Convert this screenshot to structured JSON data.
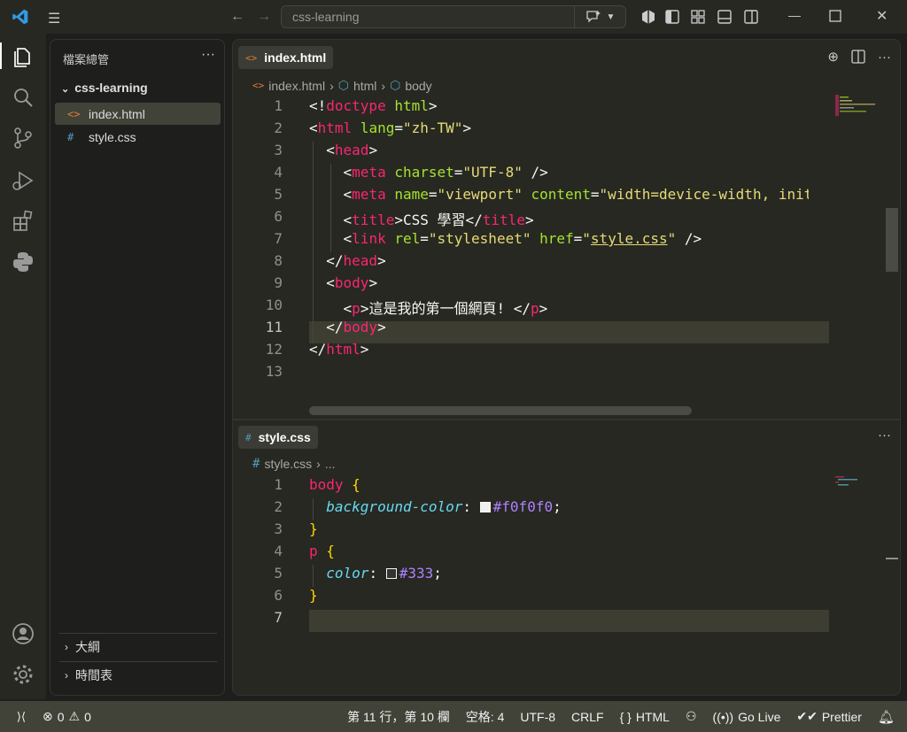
{
  "titlebar": {
    "search_text": "css-learning",
    "menu_icon": "hamburger-icon",
    "back_icon": "arrow-left-icon",
    "forward_icon": "arrow-right-icon"
  },
  "sidebar": {
    "title": "檔案總管",
    "folder": "css-learning",
    "files": [
      {
        "name": "index.html",
        "icon": "<>",
        "icon_color": "#e37933"
      },
      {
        "name": "style.css",
        "icon": "#",
        "icon_color": "#519aba"
      }
    ],
    "sections": [
      "大綱",
      "時間表"
    ]
  },
  "editor_top": {
    "tab_label": "index.html",
    "tab_icon": "<>",
    "breadcrumb": [
      "index.html",
      "html",
      "body"
    ],
    "current_line": 11
  },
  "editor_bottom": {
    "tab_label": "style.css",
    "tab_icon": "#",
    "breadcrumb": [
      "style.css",
      "..."
    ],
    "current_line": 7
  },
  "html_lines": [
    "1",
    "2",
    "3",
    "4",
    "5",
    "6",
    "7",
    "8",
    "9",
    "10",
    "11",
    "12",
    "13"
  ],
  "css_lines": [
    "1",
    "2",
    "3",
    "4",
    "5",
    "6",
    "7"
  ],
  "html_code": {
    "l1a": "<!",
    "l1b": "doctype",
    "l1c": " html",
    "l1d": ">",
    "l2a": "<",
    "l2b": "html",
    "l2c": " lang",
    "l2d": "=",
    "l2e": "\"zh-TW\"",
    "l2f": ">",
    "l3a": "<",
    "l3b": "head",
    "l3c": ">",
    "l4a": "<",
    "l4b": "meta",
    "l4c": " charset",
    "l4d": "=",
    "l4e": "\"UTF-8\"",
    "l4f": " />",
    "l5a": "<",
    "l5b": "meta",
    "l5c": " name",
    "l5d": "=",
    "l5e": "\"viewport\"",
    "l5f": " content",
    "l5g": "=",
    "l5h": "\"width=device-width, initial-sc",
    "l6a": "<",
    "l6b": "title",
    "l6c": ">CSS 學習</",
    "l6d": "title",
    "l6e": ">",
    "l7a": "<",
    "l7b": "link",
    "l7c": " rel",
    "l7d": "=",
    "l7e": "\"stylesheet\"",
    "l7f": " href",
    "l7g": "=",
    "l7h": "\"",
    "l7i": "style.css",
    "l7j": "\"",
    "l7k": " />",
    "l8a": "</",
    "l8b": "head",
    "l8c": ">",
    "l9a": "<",
    "l9b": "body",
    "l9c": ">",
    "l10a": "<",
    "l10b": "p",
    "l10c": ">這是我的第一個網頁! </",
    "l10d": "p",
    "l10e": ">",
    "l11a": "</",
    "l11b": "body",
    "l11c": ">",
    "l12a": "</",
    "l12b": "html",
    "l12c": ">"
  },
  "css_code": {
    "l1a": "body",
    "l1b": " {",
    "l2a": "background-color",
    "l2b": ": ",
    "l2c": "#f0f0f0",
    "l2d": ";",
    "l3a": "}",
    "l4a": "p",
    "l4b": " {",
    "l5a": "color",
    "l5b": ": ",
    "l5c": "#333",
    "l5d": ";",
    "l6a": "}"
  },
  "swatch_colors": [
    "#f0f0f0",
    "#333333"
  ],
  "status": {
    "errors": "0",
    "warnings": "0",
    "position": "第 11 行，第 10 欄",
    "spaces": "空格: 4",
    "encoding": "UTF-8",
    "eol": "CRLF",
    "language": "HTML",
    "golive": "Go Live",
    "prettier": "Prettier"
  },
  "colors": {
    "accent_tag": "#f92672",
    "accent_attr": "#a6e22e",
    "accent_string": "#e6db74",
    "accent_value": "#ae81ff",
    "accent_prop": "#66d9ef",
    "editor_bg": "#272822",
    "statusbar_bg": "#414339"
  }
}
